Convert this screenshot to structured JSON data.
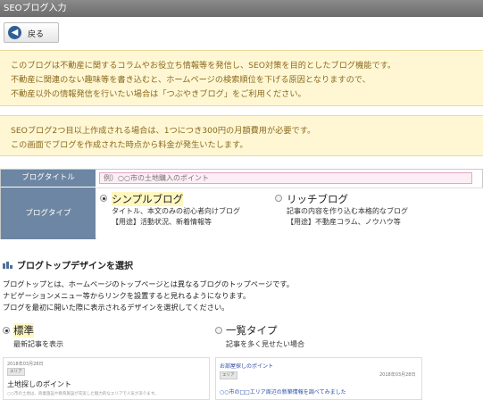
{
  "window": {
    "title": "SEOブログ入力"
  },
  "toolbar": {
    "back_label": "戻る",
    "back_icon": "arrow-left-icon"
  },
  "notice1": {
    "lines": [
      "このブログは不動産に関するコラムやお役立ち情報等を発信し、SEO対策を目的としたブログ機能です。",
      "不動産に関連のない趣味等を書き込むと、ホームページの検索順位を下げる原因となりますので、",
      "不動産以外の情報発信を行いたい場合は「つぶやきブログ」をご利用ください。"
    ]
  },
  "notice2": {
    "lines": [
      "SEOブログ2つ目以上作成される場合は、1つにつき300円の月額費用が必要です。",
      "この画面でブログを作成された時点から料金が発生いたします。"
    ]
  },
  "form": {
    "title_label": "ブログタイトル",
    "title_value": "",
    "title_placeholder": "例）○○市の土地購入のポイント",
    "type_label": "ブログタイプ",
    "types": [
      {
        "title": "シンプルブログ",
        "checked": true,
        "desc": [
          "タイトル、本文のみの初心者向けブログ",
          "【用途】活動状況、新着情報等"
        ]
      },
      {
        "title": "リッチブログ",
        "checked": false,
        "desc": [
          "記事の内容を作り込む本格的なブログ",
          "【用途】不動産コラム、ノウハウ等"
        ]
      }
    ]
  },
  "design_section": {
    "title": "ブログトップデザインを選択",
    "icon": "grid-bars-icon",
    "intro": [
      "ブログトップとは、ホームページのトップページとは異なるブログのトップページです。",
      "ナビゲーションメニュー等からリンクを設置すると見れるようになります。",
      "ブログを最初に開いた際に表示されるデザインを選択してください。"
    ],
    "options": [
      {
        "title": "標準",
        "desc": "最新記事を表示",
        "checked": true
      },
      {
        "title": "一覧タイプ",
        "desc": "記事を多く見せたい場合",
        "checked": false
      }
    ]
  },
  "preview_standard": {
    "date": "2018年03月28日",
    "tag": "エリア",
    "heading": "土地探しのポイント",
    "body": "○○市の土地は、商業施設や教育施設が充実した魅力的なエリアで人気があります。"
  },
  "preview_list": {
    "title_link": "お部屋探しのポイント",
    "tag": "エリア",
    "date": "2018年03月28日",
    "item_link": "○○市の□□エリア周辺の新築情報を調べてみました"
  },
  "colors": {
    "titlebar": "#7a7a7a",
    "notice_bg": "#fff7d4",
    "notice_text": "#8a6a1e",
    "form_label_bg": "#6d86a3",
    "title_input_bg": "#fdeef5",
    "section_icon": "#4f6f98",
    "highlight": "#fff7c0"
  }
}
